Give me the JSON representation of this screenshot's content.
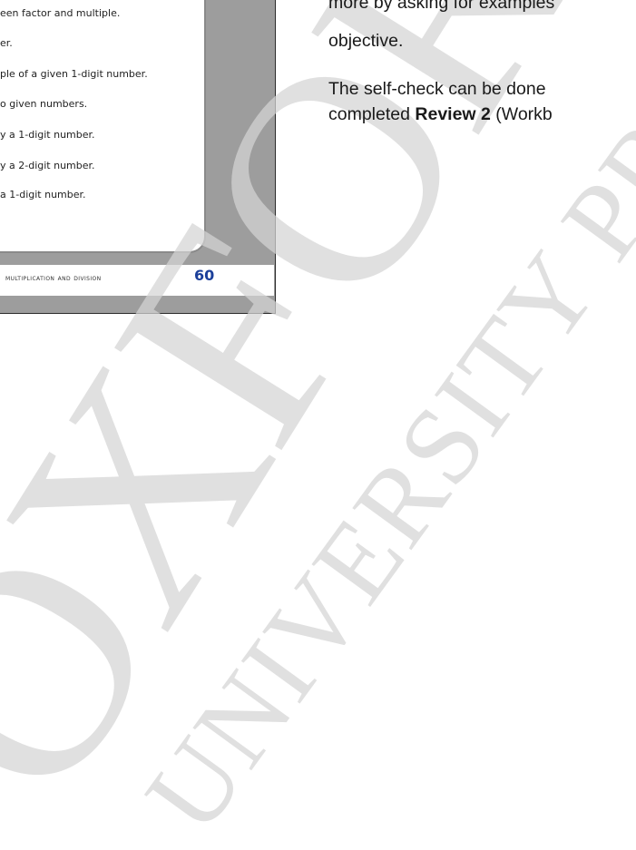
{
  "thumbnail": {
    "objectives": [
      "een factor and multiple.",
      "er.",
      "ple of a given 1-digit number.",
      "o given numbers.",
      "y a 1-digit number.",
      "y a 2-digit number.",
      "a 1-digit number."
    ],
    "footer_label": "multiplication and division",
    "page_number": "60"
  },
  "body": {
    "line1": "more by asking for examples",
    "line2": "objective.",
    "line3": "The self-check can be done",
    "line4_pre": "completed ",
    "line4_bold": "Review 2",
    "line4_post": " (Workb"
  },
  "watermark": {
    "big_text": "OXFORD",
    "small_text": "UNIVERSITY PRESS",
    "color": "#d9d9d9"
  }
}
